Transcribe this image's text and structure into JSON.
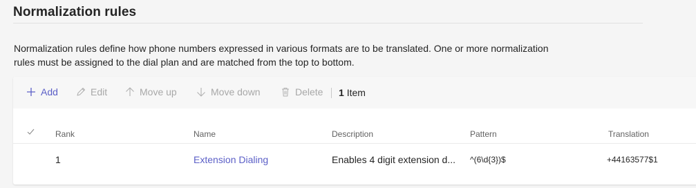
{
  "section": {
    "title": "Normalization rules",
    "description": "Normalization rules define how phone numbers expressed in various formats are to be translated. One or more normalization rules must be assigned to the dial plan and are matched from the top to bottom."
  },
  "toolbar": {
    "add": {
      "label": "Add",
      "icon": "plus-icon",
      "enabled": true
    },
    "edit": {
      "label": "Edit",
      "icon": "pencil-icon",
      "enabled": false
    },
    "move_up": {
      "label": "Move up",
      "icon": "arrow-up-icon",
      "enabled": false
    },
    "move_down": {
      "label": "Move down",
      "icon": "arrow-down-icon",
      "enabled": false
    },
    "delete": {
      "label": "Delete",
      "icon": "trash-icon",
      "enabled": false
    },
    "item_count": "1",
    "item_label": "Item"
  },
  "table": {
    "columns": {
      "select": "checkmark-icon",
      "rank": "Rank",
      "name": "Name",
      "description": "Description",
      "pattern": "Pattern",
      "translation": "Translation"
    },
    "rows": [
      {
        "rank": "1",
        "name": "Extension Dialing",
        "description": "Enables 4 digit extension d...",
        "pattern": "^(6\\d{3})$",
        "translation": "+44163577$1"
      }
    ]
  },
  "colors": {
    "accent": "#5b5fc7",
    "disabled": "#a8a8a8",
    "background": "#f5f5f5",
    "card": "#ffffff"
  }
}
